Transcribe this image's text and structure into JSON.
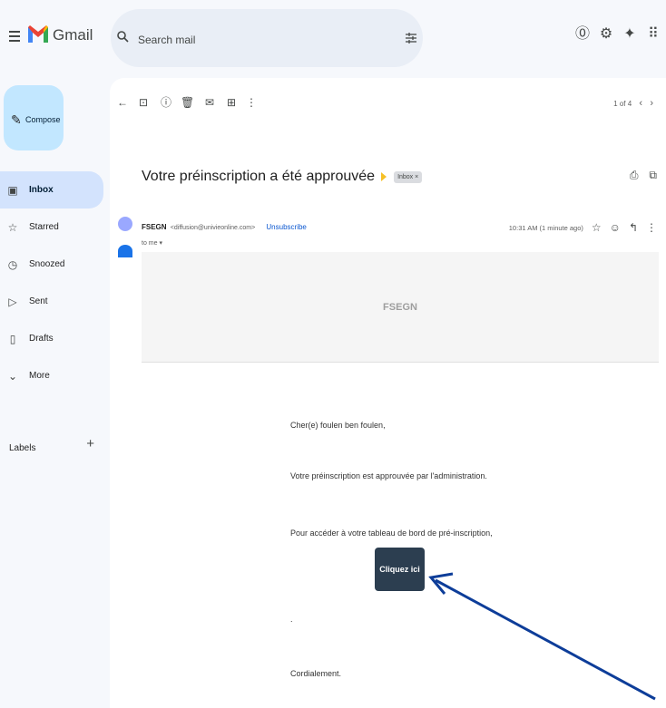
{
  "app": {
    "name": "Gmail",
    "search_placeholder": "Search mail"
  },
  "sidebar": {
    "compose_label": "Compose",
    "items": [
      {
        "label": "Inbox",
        "icon": "inbox-icon",
        "active": true
      },
      {
        "label": "Starred",
        "icon": "star-icon",
        "active": false
      },
      {
        "label": "Snoozed",
        "icon": "clock-icon",
        "active": false
      },
      {
        "label": "Sent",
        "icon": "send-icon",
        "active": false
      },
      {
        "label": "Drafts",
        "icon": "draft-icon",
        "active": false
      },
      {
        "label": "More",
        "icon": "chevron-down-icon",
        "active": false
      }
    ],
    "labels_heading": "Labels"
  },
  "toolbar": {
    "pager": "1 of 4"
  },
  "email": {
    "subject": "Votre préinscription a été approuvée",
    "label_chip": "Inbox ×",
    "sender_name": "FSEGN",
    "sender_email": "<diffusion@univieonline.com>",
    "unsubscribe": "Unsubscribe",
    "to": "to me ▾",
    "timestamp": "10:31 AM (1 minute ago)",
    "header_brand": "FSEGN",
    "greeting": "Cher(e) foulen ben foulen,",
    "line1": "Votre préinscription est approuvée par l'administration.",
    "line2": "Pour accéder à votre tableau de bord de pré-inscription,",
    "cta_label": "Cliquez ici",
    "dot": ".",
    "closing": "Cordialement."
  },
  "colors": {
    "background": "#f6f8fc",
    "compose_bg": "#c2e7ff",
    "active_nav": "#d3e3fd",
    "link": "#0b57d0",
    "cta_bg": "#2c3e50",
    "annotation_arrow": "#0d3d99"
  }
}
